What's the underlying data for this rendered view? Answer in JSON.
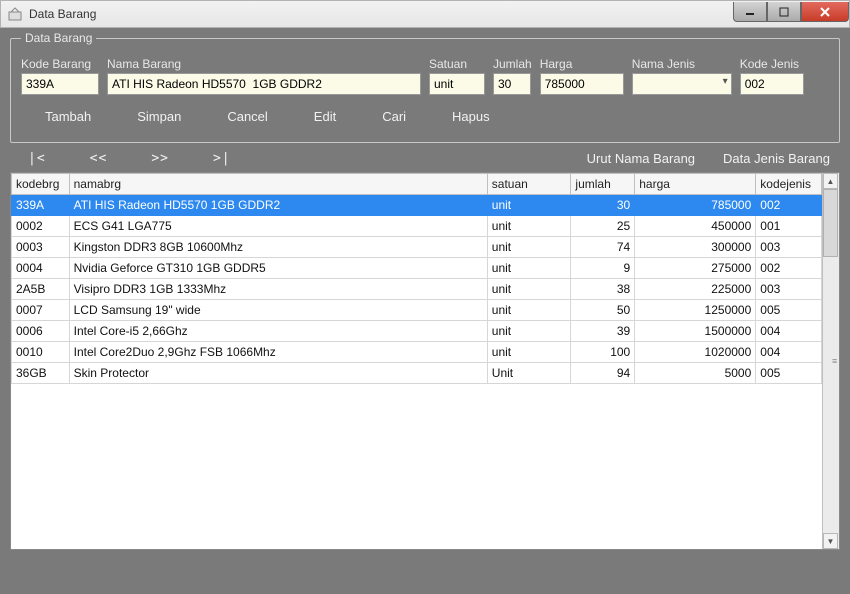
{
  "window": {
    "title": "Data Barang"
  },
  "group": {
    "legend": "Data Barang"
  },
  "labels": {
    "kode": "Kode Barang",
    "nama": "Nama Barang",
    "satuan": "Satuan",
    "jumlah": "Jumlah",
    "harga": "Harga",
    "namajenis": "Nama Jenis",
    "kodejenis": "Kode Jenis"
  },
  "form": {
    "kode": "339A",
    "nama": "ATI HIS Radeon HD5570  1GB GDDR2",
    "satuan": "unit",
    "jumlah": "30",
    "harga": "785000",
    "namajenis": "",
    "kodejenis": "002"
  },
  "actions": {
    "tambah": "Tambah",
    "simpan": "Simpan",
    "cancel": "Cancel",
    "edit": "Edit",
    "cari": "Cari",
    "hapus": "Hapus"
  },
  "nav": {
    "first": "|<",
    "prev": "<<",
    "next": ">>",
    "last": ">|",
    "urut": "Urut Nama Barang",
    "datajenis": "Data Jenis Barang"
  },
  "columns": {
    "kodebrg": "kodebrg",
    "namabrg": "namabrg",
    "satuan": "satuan",
    "jumlah": "jumlah",
    "harga": "harga",
    "kodejenis": "kodejenis"
  },
  "rows": [
    {
      "kode": "339A",
      "nama": "ATI HIS Radeon HD5570  1GB GDDR2",
      "satuan": "unit",
      "jumlah": "30",
      "harga": "785000",
      "kodejenis": "002",
      "sel": true
    },
    {
      "kode": "0002",
      "nama": "ECS G41 LGA775",
      "satuan": "unit",
      "jumlah": "25",
      "harga": "450000",
      "kodejenis": "001"
    },
    {
      "kode": "0003",
      "nama": "Kingston DDR3 8GB 10600Mhz",
      "satuan": "unit",
      "jumlah": "74",
      "harga": "300000",
      "kodejenis": "003"
    },
    {
      "kode": "0004",
      "nama": "Nvidia Geforce GT310 1GB GDDR5",
      "satuan": "unit",
      "jumlah": "9",
      "harga": "275000",
      "kodejenis": "002"
    },
    {
      "kode": "2A5B",
      "nama": "Visipro DDR3 1GB 1333Mhz",
      "satuan": "unit",
      "jumlah": "38",
      "harga": "225000",
      "kodejenis": "003"
    },
    {
      "kode": "0007",
      "nama": "LCD Samsung 19\" wide",
      "satuan": "unit",
      "jumlah": "50",
      "harga": "1250000",
      "kodejenis": "005"
    },
    {
      "kode": "0006",
      "nama": "Intel Core-i5 2,66Ghz",
      "satuan": "unit",
      "jumlah": "39",
      "harga": "1500000",
      "kodejenis": "004"
    },
    {
      "kode": "0010",
      "nama": "Intel Core2Duo 2,9Ghz FSB 1066Mhz",
      "satuan": "unit",
      "jumlah": "100",
      "harga": "1020000",
      "kodejenis": "004"
    },
    {
      "kode": "36GB",
      "nama": "Skin Protector",
      "satuan": "Unit",
      "jumlah": "94",
      "harga": "5000",
      "kodejenis": "005"
    }
  ]
}
